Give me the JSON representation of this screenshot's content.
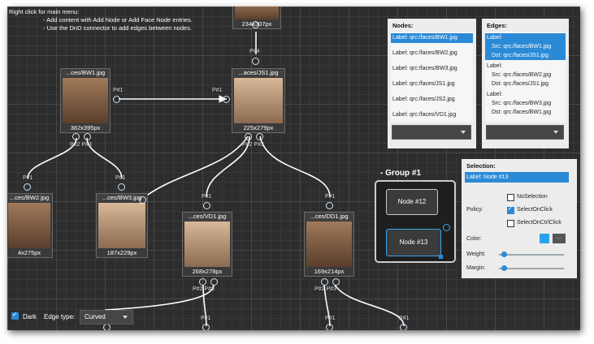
{
  "help": {
    "line1": "Right click for main menu:",
    "line2": "- Add content with Add Node or Add Face Node entries.",
    "line3": "- Use the DnD connector to add edges between nodes."
  },
  "nodes": [
    {
      "caption": "",
      "dims": "234x307px"
    },
    {
      "caption": "...ces/BW1.jpg",
      "dims": "382x395px"
    },
    {
      "caption": "...aces/JS1.jpg",
      "dims": "225x279px"
    },
    {
      "caption": "...ces/BW2.jpg",
      "dims": "4x275px"
    },
    {
      "caption": "...ces/BW3.jpg",
      "dims": "187x229px"
    },
    {
      "caption": "...ces/VD1.jpg",
      "dims": "268x278px"
    },
    {
      "caption": "...ces/DD1.jpg",
      "dims": "169x214px"
    }
  ],
  "ports": {
    "p1": "P#1",
    "p2": "P#2",
    "p3": "P#3",
    "p4": "P#4",
    "p2p3": "P#2  P#3"
  },
  "nodes_panel": {
    "title": "Nodes:",
    "items": [
      "Label: qrc:/faces/BW1.jpg",
      "Label: qrc:/faces/BW2.jpg",
      "Label: qrc:/faces/BW3.jpg",
      "Label: qrc:/faces/JS1.jpg",
      "Label: qrc:/faces/JS2.jpg",
      "Label: qrc:/faces/VD1.jpg"
    ]
  },
  "edges_panel": {
    "title": "Edges:",
    "items": [
      "Label:",
      "Src: qrc:/faces/BW1.jpg",
      "Dst: qrc:/faces/JS1.jpg",
      "Label:",
      "Src: qrc:/faces/BW2.jpg",
      "Dst: qrc:/faces/JS1.jpg",
      "Label:",
      "Src: qrc:/faces/BW3.jpg",
      "Dst: qrc:/faces/BW1.jpg"
    ]
  },
  "group": {
    "title": "-  Group #1",
    "node_a": "Node #12",
    "node_b": "Node #13"
  },
  "selection": {
    "title": "Selection:",
    "label": "Label: Node #13",
    "policy_label": "Policy:",
    "opt_none": "NoSelection",
    "opt_click": "SelectOnClick",
    "opt_ctrl": "SelectOnCtrlClick",
    "color_label": "Color:",
    "color_value": "#29a3f0",
    "more": "...",
    "weight_label": "Weight:",
    "margin_label": "Margin:",
    "weight": 0.08,
    "margin": 0.08
  },
  "bottom": {
    "dark_label": "Dark",
    "edge_type_label": "Edge type:",
    "edge_type_value": "Curved"
  },
  "colors": {
    "accent": "#2b8ad6",
    "background": "#2d2d2d"
  }
}
